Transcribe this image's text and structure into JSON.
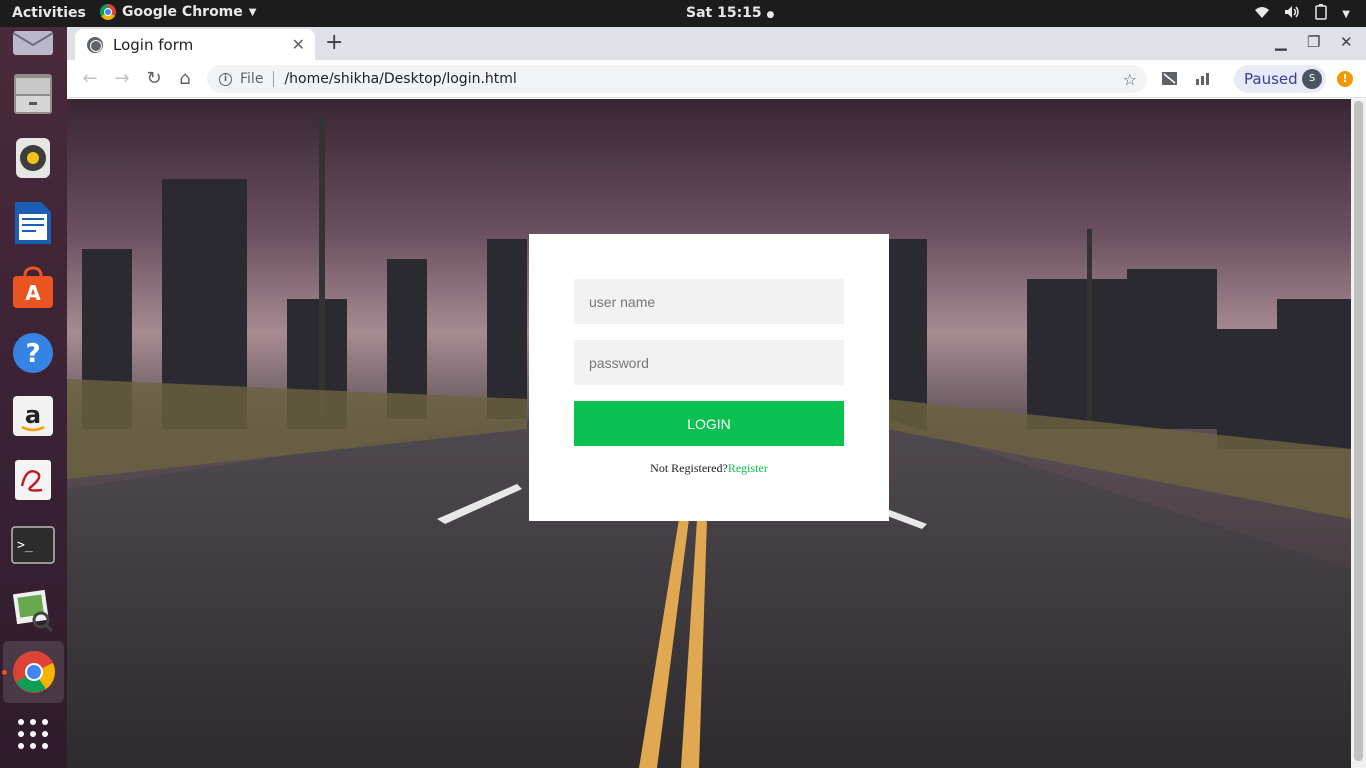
{
  "topbar": {
    "activities": "Activities",
    "app_name": "Google Chrome",
    "clock": "Sat 15:15"
  },
  "dock": {
    "items": [
      "mail",
      "files",
      "rhythmbox",
      "writer",
      "software",
      "help",
      "amazon",
      "evince",
      "terminal",
      "image-viewer",
      "chrome",
      "show-apps"
    ]
  },
  "browser": {
    "tab_title": "Login form",
    "address_scheme": "File",
    "address_url": "/home/shikha/Desktop/login.html",
    "profile_status": "Paused",
    "profile_initial": "S"
  },
  "login": {
    "username_placeholder": "user name",
    "password_placeholder": "password",
    "button_label": "LOGIN",
    "message": "Not Registered?",
    "register_link": "Register"
  },
  "colors": {
    "accent": "#0ac050",
    "card": "#ffffff",
    "input_bg": "#f2f2f2"
  }
}
